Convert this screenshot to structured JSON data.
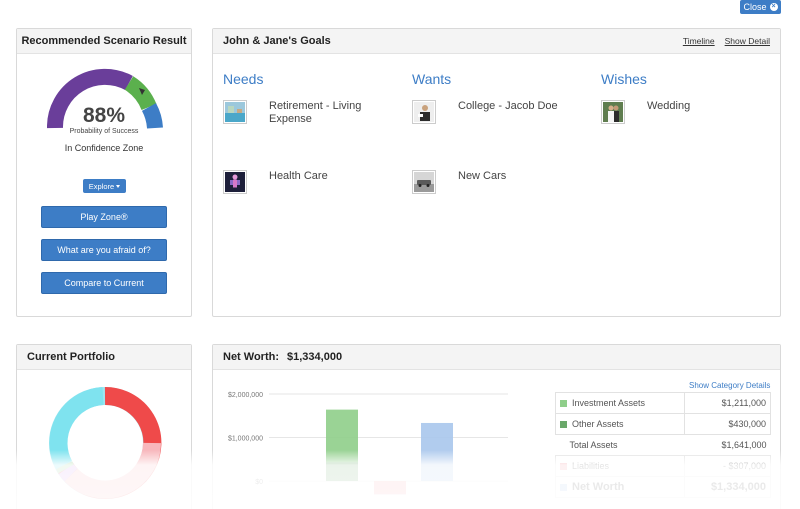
{
  "close_label": "Close",
  "recommended": {
    "title": "Recommended Scenario Result",
    "percent": "88%",
    "probability_label": "Probability of Success",
    "zone_label": "In Confidence Zone",
    "explore_label": "Explore",
    "buttons": [
      "Play Zone®",
      "What are you afraid of?",
      "Compare to Current"
    ],
    "gauge": {
      "value": 0.88,
      "colors": {
        "purple": "#6a3e9a",
        "green": "#5bb04d",
        "blue": "#3d7dc6"
      }
    }
  },
  "goals": {
    "title": "John & Jane's Goals",
    "links": [
      "Timeline",
      "Show Detail"
    ],
    "columns": [
      {
        "title": "Needs",
        "items": [
          {
            "label": "Retirement - Living Expense",
            "icon": "retirement-photo-icon"
          },
          {
            "label": "Health Care",
            "icon": "health-care-photo-icon"
          }
        ]
      },
      {
        "title": "Wants",
        "items": [
          {
            "label": "College - Jacob Doe",
            "icon": "college-photo-icon"
          },
          {
            "label": "New Cars",
            "icon": "car-photo-icon"
          }
        ]
      },
      {
        "title": "Wishes",
        "items": [
          {
            "label": "Wedding",
            "icon": "wedding-photo-icon"
          }
        ]
      }
    ]
  },
  "portfolio": {
    "title": "Current Portfolio",
    "colors": [
      "#ef4a4a",
      "#f6a1a8",
      "#c28ee0",
      "#9fd0a0",
      "#7fe3ef",
      "#cfe9ff"
    ]
  },
  "net_worth": {
    "title": "Net Worth:",
    "value": "$1,334,000",
    "category_link": "Show Category Details",
    "rows": [
      {
        "label": "Investment Assets",
        "value": "$1,211,000",
        "color": "#8fce8a"
      },
      {
        "label": "Other Assets",
        "value": "$430,000",
        "color": "#6aa86a"
      },
      {
        "label": "Total Assets",
        "value": "$1,641,000",
        "color": ""
      },
      {
        "label": "Liabilities",
        "value": "- $307,000",
        "color": "#f4a0a6"
      },
      {
        "label": "Net Worth",
        "value": "$1,334,000",
        "color": "#a9c6ec"
      }
    ]
  },
  "chart_data": {
    "type": "bar",
    "yticks": [
      "$2,000,000",
      "$1,000,000",
      "$0"
    ],
    "ylim": [
      0,
      2000000
    ],
    "bars": [
      {
        "name": "Investment Assets",
        "value": 1211000,
        "base": 430000,
        "color": "#8fce8a"
      },
      {
        "name": "Other Assets",
        "value": 430000,
        "base": 0,
        "color": "#6aa86a"
      },
      {
        "name": "Liabilities",
        "value": -307000,
        "base": 0,
        "color": "#f4a0a6"
      },
      {
        "name": "Net Worth",
        "value": 1334000,
        "base": 0,
        "color": "#a9c6ec"
      }
    ]
  }
}
